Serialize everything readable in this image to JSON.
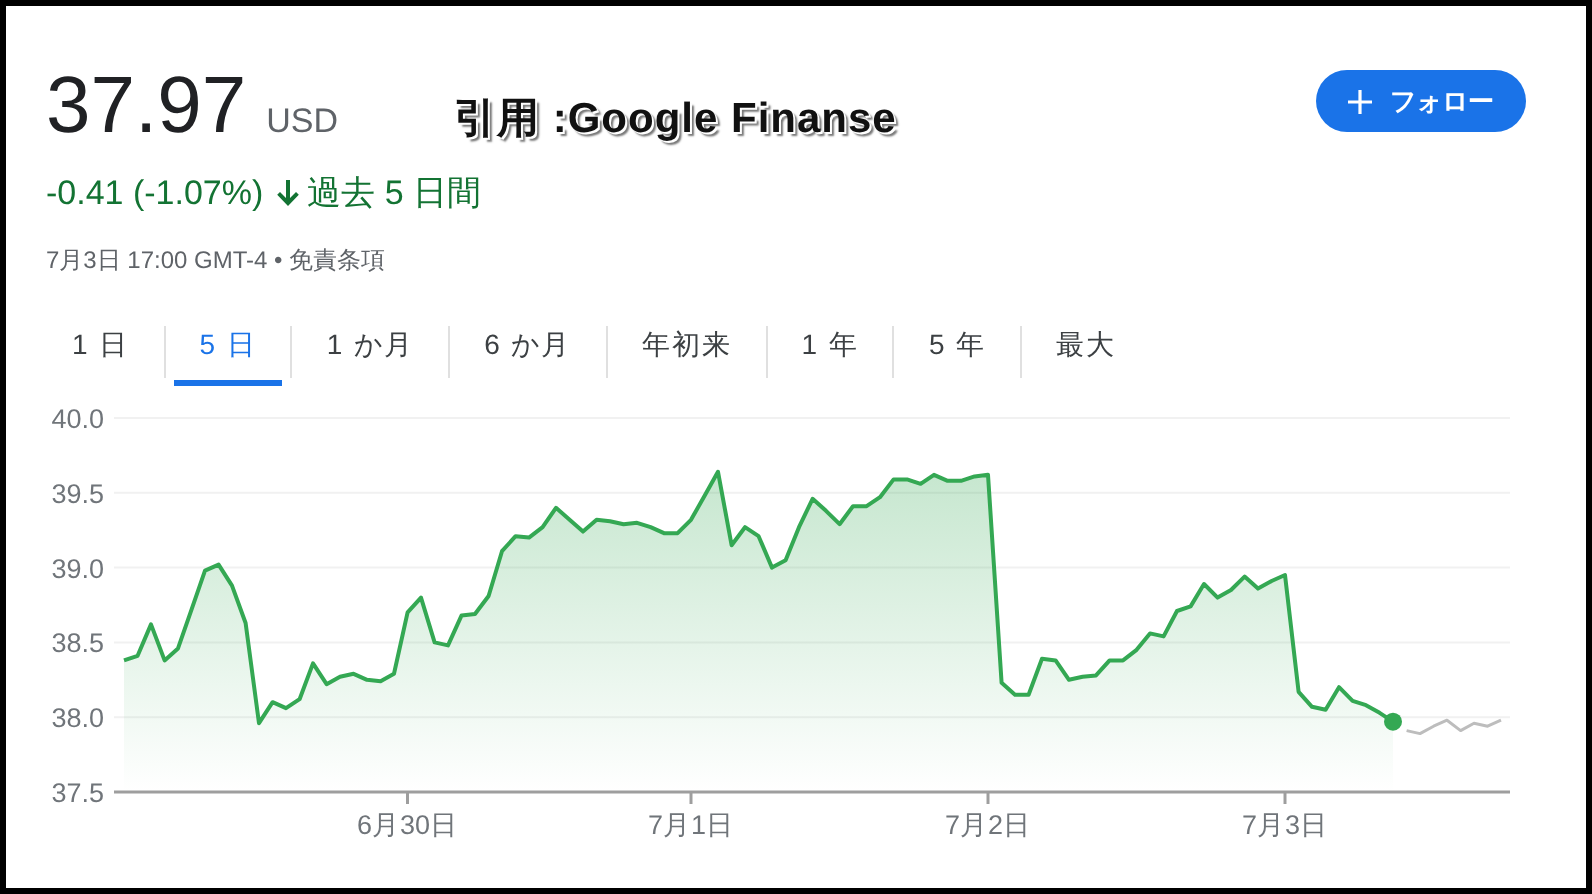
{
  "quote": {
    "price": "37.97",
    "currency": "USD",
    "change": "-0.41 (-1.07%)",
    "period": "過去 5 日間",
    "timestamp": "7月3日 17:00 GMT-4 • 免責条項"
  },
  "caption": "引用 :Google Finanse",
  "follow_button": {
    "label": "フォロー"
  },
  "tabs": [
    {
      "label": "1 日",
      "selected": false
    },
    {
      "label": "5 日",
      "selected": true
    },
    {
      "label": "1 か月",
      "selected": false
    },
    {
      "label": "6 か月",
      "selected": false
    },
    {
      "label": "年初来",
      "selected": false
    },
    {
      "label": "1 年",
      "selected": false
    },
    {
      "label": "5 年",
      "selected": false
    },
    {
      "label": "最大",
      "selected": false
    }
  ],
  "chart_data": {
    "type": "area",
    "grid": true,
    "ylim": [
      37.5,
      40
    ],
    "yticks": [
      {
        "value": 37.5,
        "label": "37.5"
      },
      {
        "value": 38,
        "label": "38.0"
      },
      {
        "value": 38.5,
        "label": "38.5"
      },
      {
        "value": 39,
        "label": "39.0"
      },
      {
        "value": 39.5,
        "label": "39.5"
      },
      {
        "value": 40,
        "label": "40.0"
      }
    ],
    "categories": [
      null,
      null,
      null,
      null,
      null,
      null,
      null,
      null,
      null,
      null,
      null,
      null,
      null,
      null,
      null,
      null,
      null,
      null,
      null,
      null,
      null,
      "6月30日",
      null,
      null,
      null,
      null,
      null,
      null,
      null,
      null,
      null,
      null,
      null,
      null,
      null,
      null,
      null,
      null,
      null,
      null,
      null,
      null,
      "7月1日",
      null,
      null,
      null,
      null,
      null,
      null,
      null,
      null,
      null,
      null,
      null,
      null,
      null,
      null,
      null,
      null,
      null,
      null,
      null,
      null,
      null,
      "7月2日",
      null,
      null,
      null,
      null,
      null,
      null,
      null,
      null,
      null,
      null,
      null,
      null,
      null,
      null,
      null,
      null,
      null,
      null,
      null,
      null,
      null,
      "7月3日",
      null,
      null,
      null,
      null,
      null,
      null,
      null,
      null,
      null,
      null,
      null,
      null,
      null,
      null,
      null,
      null
    ],
    "series": [
      {
        "color": "#34a853",
        "values": [
          38.38,
          38.41,
          38.62,
          38.38,
          38.46,
          38.72,
          38.98,
          39.02,
          38.88,
          38.63,
          37.96,
          38.1,
          38.06,
          38.12,
          38.36,
          38.22,
          38.27,
          38.29,
          38.25,
          38.24,
          38.29,
          38.7,
          38.8,
          38.5,
          38.48,
          38.68,
          38.69,
          38.81,
          39.11,
          39.21,
          39.2,
          39.27,
          39.4,
          39.32,
          39.24,
          39.32,
          39.31,
          39.29,
          39.3,
          39.27,
          39.23,
          39.23,
          39.32,
          39.48,
          39.64,
          39.15,
          39.27,
          39.21,
          39.0,
          39.05,
          39.27,
          39.46,
          39.38,
          39.29,
          39.41,
          39.41,
          39.47,
          39.59,
          39.59,
          39.56,
          39.62,
          39.58,
          39.58,
          39.61,
          39.62,
          38.23,
          38.15,
          38.15,
          38.39,
          38.38,
          38.25,
          38.27,
          38.28,
          38.38,
          38.38,
          38.45,
          38.56,
          38.54,
          38.71,
          38.74,
          38.89,
          38.8,
          38.85,
          38.94,
          38.86,
          38.91,
          38.95,
          38.17,
          38.07,
          38.05,
          38.2,
          38.11,
          38.08,
          38.03,
          37.97,
          null,
          null,
          null,
          null,
          null,
          null,
          null,
          null
        ]
      },
      {
        "type": "line",
        "color": "#bdbdbd",
        "values": [
          null,
          null,
          null,
          null,
          null,
          null,
          null,
          null,
          null,
          null,
          null,
          null,
          null,
          null,
          null,
          null,
          null,
          null,
          null,
          null,
          null,
          null,
          null,
          null,
          null,
          null,
          null,
          null,
          null,
          null,
          null,
          null,
          null,
          null,
          null,
          null,
          null,
          null,
          null,
          null,
          null,
          null,
          null,
          null,
          null,
          null,
          null,
          null,
          null,
          null,
          null,
          null,
          null,
          null,
          null,
          null,
          null,
          null,
          null,
          null,
          null,
          null,
          null,
          null,
          null,
          null,
          null,
          null,
          null,
          null,
          null,
          null,
          null,
          null,
          null,
          null,
          null,
          null,
          null,
          null,
          null,
          null,
          null,
          null,
          null,
          null,
          null,
          null,
          null,
          null,
          null,
          null,
          null,
          null,
          null,
          37.91,
          37.89,
          37.94,
          37.98,
          37.91,
          37.96,
          37.94,
          37.98
        ]
      }
    ]
  }
}
